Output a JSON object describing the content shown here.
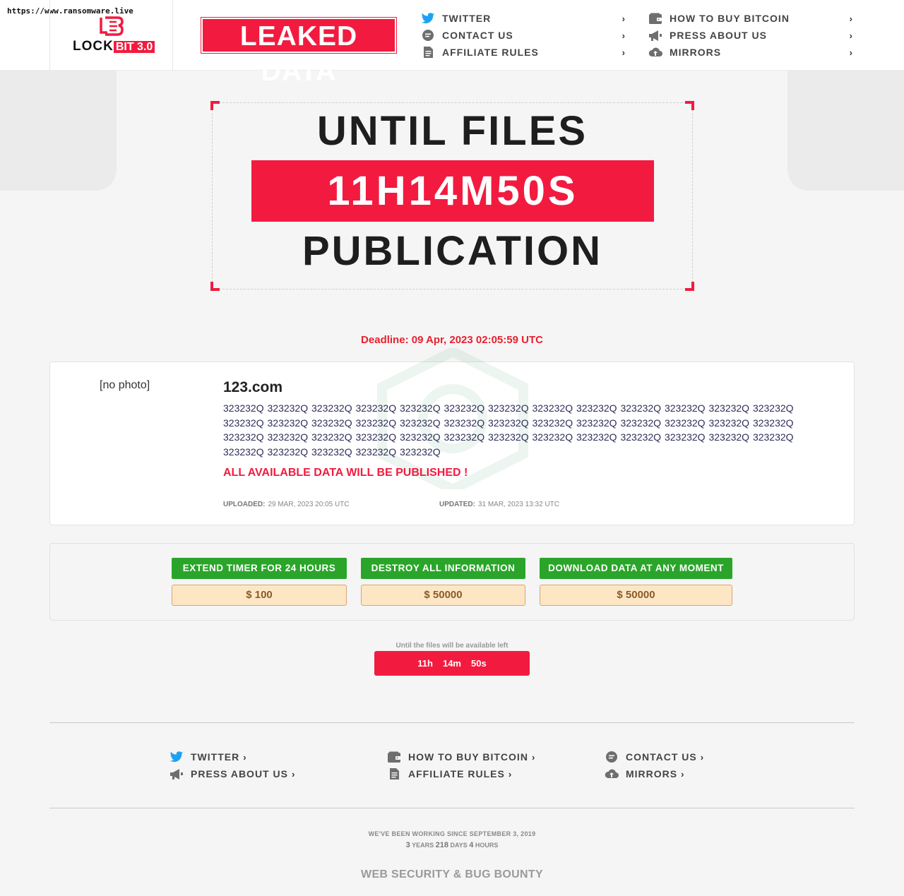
{
  "source_url": "https://www.ransomware.live",
  "logo": {
    "brand": "LOCK",
    "tag": "BIT 3.0"
  },
  "banner": "LEAKED DATA",
  "nav": {
    "col1": [
      {
        "label": "TWITTER",
        "icon": "twitter-icon"
      },
      {
        "label": "CONTACT US",
        "icon": "chat-icon"
      },
      {
        "label": "AFFILIATE RULES",
        "icon": "document-icon"
      }
    ],
    "col2": [
      {
        "label": "HOW TO BUY BITCOIN",
        "icon": "wallet-icon"
      },
      {
        "label": "PRESS ABOUT US",
        "icon": "megaphone-icon"
      },
      {
        "label": "MIRRORS",
        "icon": "cloud-upload-icon"
      }
    ],
    "chevron": "›"
  },
  "countdown": {
    "line1": "UNTIL FILES",
    "timer": "11H14M50S",
    "line2": "PUBLICATION"
  },
  "deadline": "Deadline: 09 Apr, 2023 02:05:59 UTC",
  "post": {
    "photo_placeholder": "[no photo]",
    "title": "123.com",
    "description": "323232Q 323232Q 323232Q 323232Q 323232Q 323232Q 323232Q 323232Q 323232Q 323232Q 323232Q 323232Q 323232Q 323232Q 323232Q 323232Q 323232Q 323232Q 323232Q 323232Q 323232Q 323232Q 323232Q 323232Q 323232Q 323232Q 323232Q 323232Q 323232Q 323232Q 323232Q 323232Q 323232Q 323232Q 323232Q 323232Q 323232Q 323232Q 323232Q 323232Q 323232Q 323232Q 323232Q 323232Q",
    "warning": "ALL AVAILABLE DATA WILL BE PUBLISHED !",
    "uploaded_label": "UPLOADED:",
    "uploaded_value": "29 MAR, 2023 20:05 UTC",
    "updated_label": "UPDATED:",
    "updated_value": "31 MAR, 2023 13:32 UTC"
  },
  "actions": [
    {
      "label": "EXTEND TIMER FOR 24 HOURS",
      "price": "$ 100"
    },
    {
      "label": "DESTROY ALL INFORMATION",
      "price": "$ 50000"
    },
    {
      "label": "DOWNLOAD DATA AT ANY MOMENT",
      "price": "$ 50000"
    }
  ],
  "files_left": {
    "caption": "Until the files will be available left",
    "hours": "11h",
    "minutes": "14m",
    "seconds": "50s"
  },
  "footer_nav": {
    "col1": [
      {
        "label": "TWITTER",
        "icon": "twitter-icon"
      },
      {
        "label": "PRESS ABOUT US",
        "icon": "megaphone-icon"
      }
    ],
    "col2": [
      {
        "label": "HOW TO BUY BITCOIN",
        "icon": "wallet-icon"
      },
      {
        "label": "AFFILIATE RULES",
        "icon": "document-icon"
      }
    ],
    "col3": [
      {
        "label": "CONTACT US",
        "icon": "chat-icon"
      },
      {
        "label": "MIRRORS",
        "icon": "cloud-upload-icon"
      }
    ],
    "chevron": "›"
  },
  "working_since": "WE'VE BEEN WORKING SINCE SEPTEMBER 3, 2019",
  "duration": {
    "years": "3",
    "years_label": "YEARS",
    "days": "218",
    "days_label": "DAYS",
    "hours": "4",
    "hours_label": "HOURS"
  },
  "bottom_title": "WEB SECURITY & BUG BOUNTY",
  "colors": {
    "accent_red": "#f21b3f",
    "button_green": "#2aa52a",
    "price_bg": "#fde6c4",
    "twitter_blue": "#1da1f2"
  }
}
